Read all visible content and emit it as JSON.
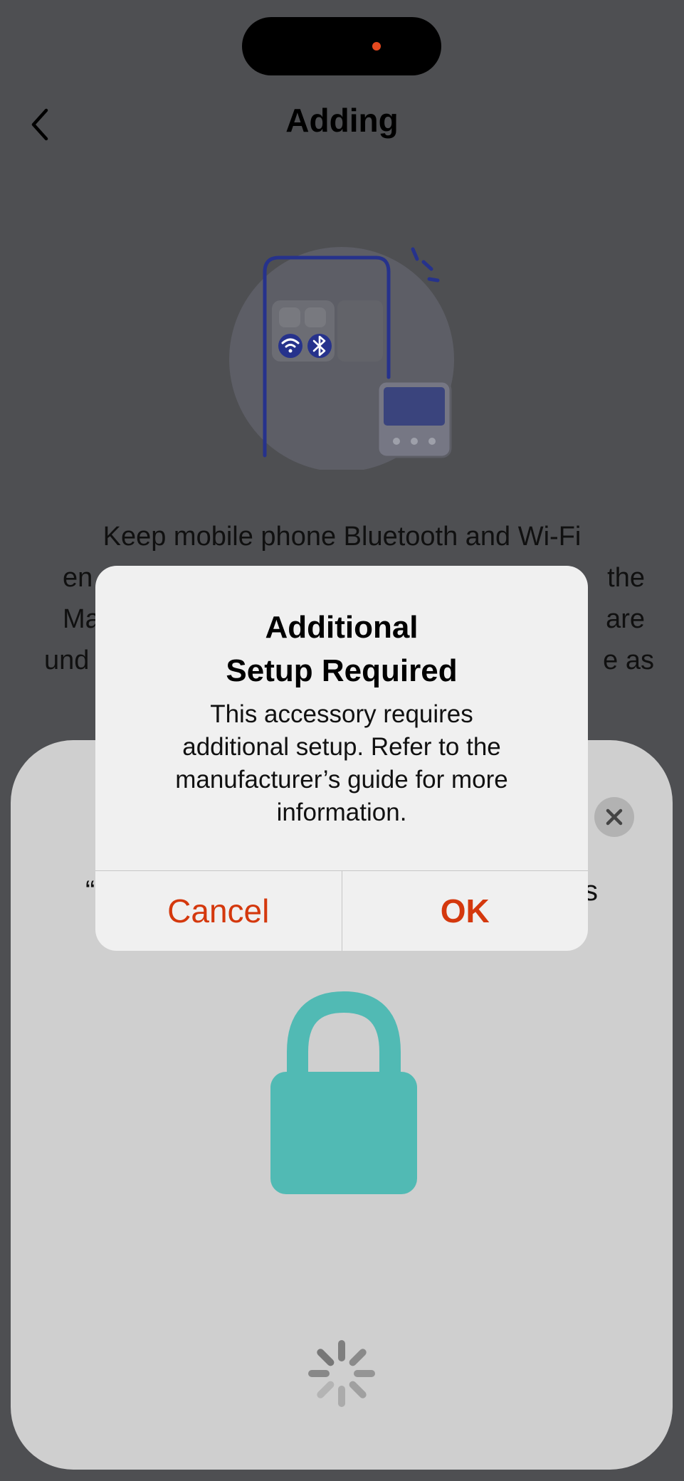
{
  "nav": {
    "title": "Adding",
    "back_icon": "chevron-left-icon"
  },
  "instructions": {
    "line1": "Keep mobile phone Bluetooth and Wi-Fi",
    "line2": "en",
    "line2_end": "the",
    "line3": "Ma",
    "line3_end": "are",
    "line4": "und",
    "line4_end": "e as"
  },
  "illustration": {
    "icons": [
      "wifi-icon",
      "bluetooth-icon",
      "device-icon"
    ],
    "accent_color": "#26328c"
  },
  "sheet": {
    "partial_text_left": "“",
    "partial_text_right": "s",
    "close_icon": "close-icon",
    "lock_icon": "lock-icon",
    "lock_color": "#51bab4",
    "spinner_icon": "loading-spinner-icon"
  },
  "alert": {
    "title_line1": "Additional",
    "title_line2": "Setup Required",
    "message_lines": [
      "This accessory requires",
      "additional setup. Refer to the",
      "manufacturer’s guide for more",
      "information."
    ],
    "cancel_label": "Cancel",
    "ok_label": "OK",
    "action_color": "#d4380d"
  }
}
